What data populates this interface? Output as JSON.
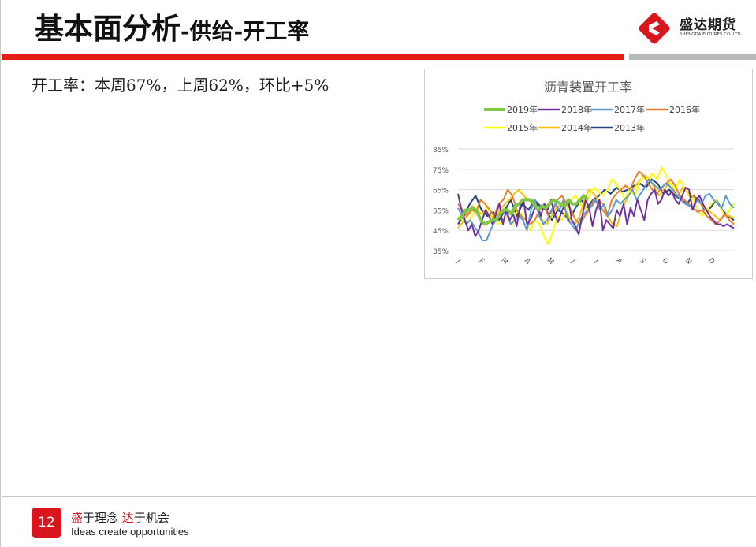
{
  "title": {
    "main": "基本面分析",
    "sub": "-供给-开工率"
  },
  "logo": {
    "name": "盛达期货",
    "english": "SHENGDA FUTURES CO.,LTD."
  },
  "stat_text": "开工率：本周67%，上周62%，环比+5%",
  "footer": {
    "page_number": "12",
    "slogan_cn": {
      "part1": "盛",
      "part2": "于理念 ",
      "part3": "达",
      "part4": "于机会"
    },
    "slogan_en": "Ideas create opportunities"
  },
  "colors": {
    "brand_red": "#e41e14",
    "divider_gray": "#b8b8b8"
  },
  "chart_data": {
    "type": "line",
    "title": "沥青装置开工率",
    "ylim": [
      35,
      85
    ],
    "yticks": [
      "35%",
      "45%",
      "55%",
      "65%",
      "75%",
      "85%"
    ],
    "categories": [
      "J",
      "F",
      "M",
      "A",
      "M",
      "J",
      "J",
      "A",
      "S",
      "O",
      "N",
      "D"
    ],
    "grid": true,
    "legend_position": "top",
    "series": [
      {
        "name": "2019年",
        "color": "#7ec845",
        "width": 4,
        "values": [
          50,
          52,
          55,
          55,
          56,
          54,
          50,
          48,
          49,
          50,
          50,
          53,
          55,
          55,
          53,
          57,
          58,
          60,
          60,
          60,
          58,
          55,
          57,
          56,
          58,
          60,
          59,
          58,
          57,
          60,
          58,
          58,
          60,
          62,
          60
        ]
      },
      {
        "name": "2018年",
        "color": "#7030a0",
        "width": 2,
        "values": [
          63,
          55,
          50,
          45,
          48,
          42,
          45,
          50,
          55,
          52,
          48,
          53,
          58,
          48,
          55,
          50,
          53,
          47,
          57,
          60,
          48,
          50,
          55,
          58,
          52,
          58,
          55,
          60,
          53,
          49,
          54,
          58,
          60,
          50,
          47,
          43,
          52,
          60,
          56,
          47,
          55,
          60,
          45,
          50,
          48,
          46,
          55,
          52,
          58,
          48,
          56,
          52,
          60,
          55,
          50,
          60,
          63,
          65,
          58,
          60,
          65,
          62,
          64,
          60,
          58,
          62,
          66,
          65,
          55,
          60,
          62,
          58,
          55,
          52,
          50,
          48,
          48,
          47,
          48,
          47,
          46
        ]
      },
      {
        "name": "2017年",
        "color": "#5b9bd5",
        "width": 2,
        "values": [
          56,
          52,
          48,
          50,
          47,
          44,
          40,
          40,
          45,
          49,
          51,
          55,
          53,
          48,
          50,
          52,
          50,
          45,
          55,
          60,
          52,
          48,
          50,
          55,
          58,
          55,
          60,
          50,
          48,
          45,
          50,
          53,
          55,
          57,
          60,
          55,
          58,
          52,
          55,
          60,
          58,
          60,
          62,
          65,
          60,
          63,
          66,
          70,
          68,
          66,
          65,
          68,
          67,
          65,
          62,
          60,
          58,
          57,
          56,
          60,
          58,
          62,
          63,
          60,
          58,
          56,
          62,
          58,
          56
        ]
      },
      {
        "name": "2016年",
        "color": "#ed7d31",
        "width": 2,
        "values": [
          58,
          55,
          52,
          55,
          54,
          60,
          58,
          55,
          52,
          58,
          60,
          65,
          62,
          55,
          52,
          50,
          48,
          50,
          55,
          57,
          52,
          55,
          60,
          62,
          58,
          55,
          50,
          48,
          52,
          55,
          60,
          58,
          55,
          52,
          60,
          63,
          65,
          67,
          65,
          70,
          74,
          72,
          68,
          65,
          63,
          66,
          68,
          70,
          67,
          62,
          60,
          58,
          56,
          54,
          55,
          52,
          50,
          48,
          50,
          53,
          50,
          48
        ]
      },
      {
        "name": "2015年",
        "color": "#ffff00",
        "width": 2,
        "values": [
          52,
          50,
          48,
          52,
          55,
          60,
          58,
          52,
          50,
          48,
          50,
          52,
          48,
          55,
          53,
          50,
          45,
          50,
          48,
          42,
          38,
          45,
          52,
          50,
          55,
          60,
          62,
          58,
          55,
          62,
          66,
          64,
          62,
          65,
          70,
          68,
          64,
          60,
          66,
          62,
          68,
          72,
          70,
          73,
          70,
          76,
          72,
          68,
          65,
          70,
          66,
          62,
          60,
          55,
          52,
          55,
          58,
          60,
          56,
          52,
          55,
          58
        ]
      },
      {
        "name": "2014年",
        "color": "#ffc000",
        "width": 2,
        "values": [
          46,
          49,
          53,
          57,
          55,
          53,
          55,
          52,
          51,
          55,
          58,
          60,
          63,
          65,
          62,
          60,
          58,
          55,
          50,
          48,
          52,
          56,
          58,
          55,
          50,
          48,
          52,
          60,
          65,
          63,
          60,
          58,
          52,
          48,
          47,
          55,
          60,
          64,
          67,
          70,
          72,
          70,
          66,
          62,
          65,
          68,
          64,
          62,
          66,
          64,
          62,
          60,
          58,
          55,
          54,
          52,
          50,
          53,
          52,
          51
        ]
      },
      {
        "name": "2013年",
        "color": "#264478",
        "width": 2,
        "values": [
          48,
          52,
          58,
          62,
          55,
          52,
          54,
          50,
          55,
          60,
          52,
          58,
          55,
          60,
          57,
          55,
          50,
          55,
          53,
          50,
          56,
          60,
          56,
          60,
          62,
          65,
          63,
          66,
          64,
          65,
          67,
          68,
          66,
          70,
          68,
          63,
          65,
          62,
          60,
          58,
          62,
          60,
          55,
          56,
          60,
          55,
          52,
          50
        ]
      }
    ]
  }
}
